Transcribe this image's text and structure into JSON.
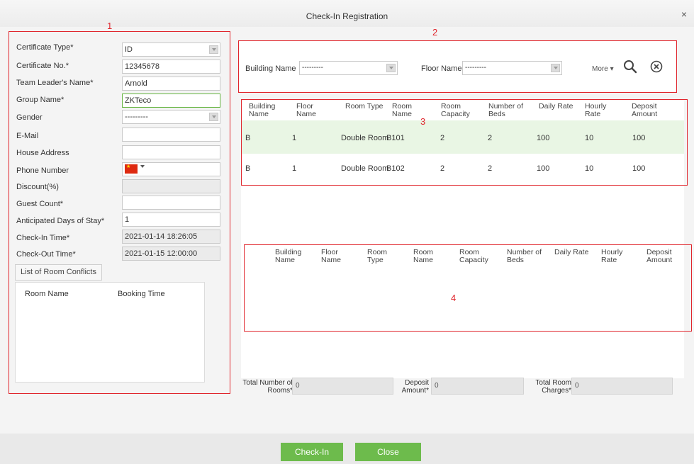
{
  "window": {
    "title": "Check-In Registration",
    "close_symbol": "×"
  },
  "markers": {
    "m1": "1",
    "m2": "2",
    "m3": "3",
    "m4": "4"
  },
  "form": {
    "certificate_type": {
      "label": "Certificate Type",
      "value": "ID"
    },
    "certificate_no": {
      "label": "Certificate No.",
      "value": "12345678"
    },
    "team_leader": {
      "label": "Team Leader's Name",
      "value": "Arnold"
    },
    "group_name": {
      "label": "Group Name",
      "value": "ZKTeco"
    },
    "gender": {
      "label": "Gender",
      "value": "---------"
    },
    "email": {
      "label": "E-Mail",
      "value": ""
    },
    "house_address": {
      "label": "House Address",
      "value": ""
    },
    "phone": {
      "label": "Phone Number",
      "value": ""
    },
    "discount": {
      "label": "Discount(%)",
      "value": ""
    },
    "guest_count": {
      "label": "Guest Count",
      "value": ""
    },
    "days_of_stay": {
      "label": "Anticipated Days of Stay",
      "value": "1"
    },
    "checkin_time": {
      "label": "Check-In Time",
      "value": "2021-01-14 18:26:05"
    },
    "checkout_time": {
      "label": "Check-Out Time",
      "value": "2021-01-15 12:00:00"
    },
    "required_mark": "*"
  },
  "conflicts": {
    "button_label": "List of Room Conflicts",
    "col_room_name": "Room Name",
    "col_booking_time": "Booking Time"
  },
  "search": {
    "building_label": "Building Name",
    "building_value": "---------",
    "floor_label": "Floor Name",
    "floor_value": "---------",
    "more_label": "More"
  },
  "rooms_table": {
    "headers": [
      "Building Name",
      "Floor Name",
      "Room Type",
      "Room Name",
      "Room Capacity",
      "Number of Beds",
      "Daily Rate",
      "Hourly Rate",
      "Deposit Amount"
    ],
    "rows": [
      [
        "B",
        "1",
        "Double Room",
        "B101",
        "2",
        "2",
        "100",
        "10",
        "100"
      ],
      [
        "B",
        "1",
        "Double Room",
        "B102",
        "2",
        "2",
        "100",
        "10",
        "100"
      ]
    ]
  },
  "selected_table": {
    "headers": [
      "Building Name",
      "Floor Name",
      "Room Type",
      "Room Name",
      "Room Capacity",
      "Number of Beds",
      "Daily Rate",
      "Hourly Rate",
      "Deposit Amount"
    ]
  },
  "totals": {
    "rooms_label": "Total Number of Rooms",
    "rooms_value": "0",
    "deposit_label": "Deposit Amount",
    "deposit_value": "0",
    "charges_label": "Total Room Charges",
    "charges_value": "0"
  },
  "footer": {
    "checkin_label": "Check-In",
    "close_label": "Close"
  },
  "colors": {
    "accent_green": "#6dbb4c",
    "annotation_red": "#e0262d",
    "row_highlight": "#e9f6e4"
  }
}
